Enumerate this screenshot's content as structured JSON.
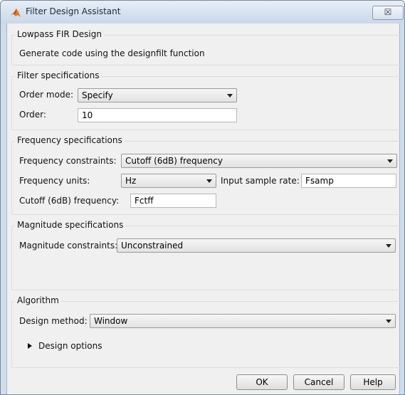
{
  "window": {
    "title": "Filter Design Assistant",
    "close_glyph": "☒"
  },
  "design": {
    "group_title": "Lowpass FIR Design",
    "subtitle": "Generate code using the designfilt function"
  },
  "filter_specs": {
    "group_title": "Filter specifications",
    "order_mode_label": "Order mode:",
    "order_mode_value": "Specify",
    "order_label": "Order:",
    "order_value": "10"
  },
  "frequency_specs": {
    "group_title": "Frequency specifications",
    "constraints_label": "Frequency constraints:",
    "constraints_value": "Cutoff (6dB) frequency",
    "units_label": "Frequency units:",
    "units_value": "Hz",
    "sample_rate_label": "Input sample rate:",
    "sample_rate_value": "Fsamp",
    "cutoff_label": "Cutoff (6dB) frequency:",
    "cutoff_value": "Fctff"
  },
  "magnitude_specs": {
    "group_title": "Magnitude specifications",
    "constraints_label": "Magnitude constraints:",
    "constraints_value": "Unconstrained"
  },
  "algorithm": {
    "group_title": "Algorithm",
    "method_label": "Design method:",
    "method_value": "Window",
    "options_label": "Design options"
  },
  "buttons": {
    "ok": "OK",
    "cancel": "Cancel",
    "help": "Help"
  },
  "icons": {
    "app": "matlab-logo-icon",
    "close": "close-icon",
    "dropdown": "chevron-down-icon",
    "expand": "triangle-right-icon"
  }
}
